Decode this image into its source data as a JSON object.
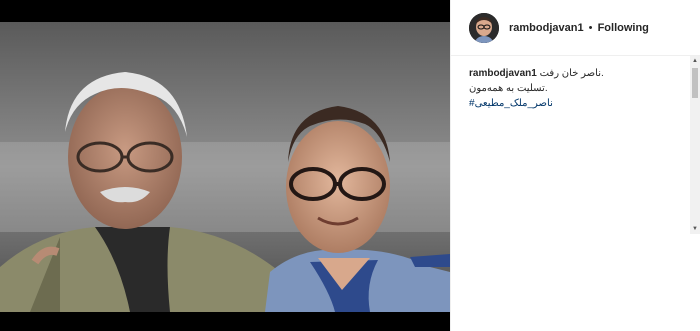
{
  "post": {
    "username": "rambodjavan1",
    "separator": "•",
    "follow_status": "Following"
  },
  "caption": {
    "username": "rambodjavan1",
    "line1": "ناصر خان رفت.",
    "line2": "تسلیت به همه‌مون.",
    "hashtag": "#ناصر_ملک_مطیعی"
  },
  "colors": {
    "text": "#262626",
    "hashtag": "#003569",
    "divider": "#efefef"
  }
}
